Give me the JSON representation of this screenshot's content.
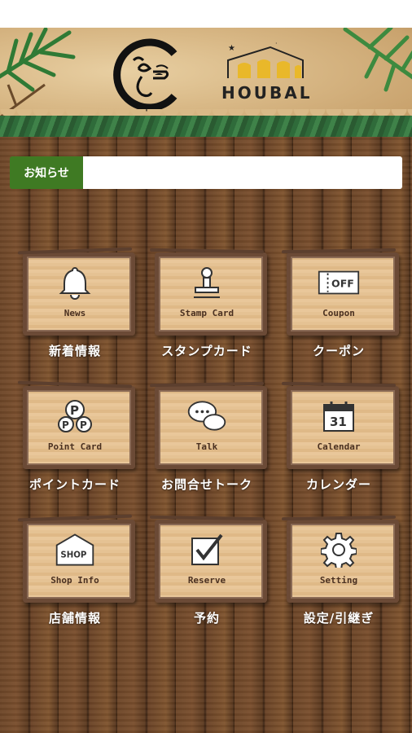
{
  "header": {
    "brand": "HOUBAL"
  },
  "notice": {
    "label": "お知らせ",
    "text": ""
  },
  "menu": [
    {
      "en": "News",
      "jp": "新着情報",
      "icon": "bell-icon"
    },
    {
      "en": "Stamp Card",
      "jp": "スタンプカード",
      "icon": "stamp-icon"
    },
    {
      "en": "Coupon",
      "jp": "クーポン",
      "icon": "coupon-icon",
      "badge": "OFF"
    },
    {
      "en": "Point Card",
      "jp": "ポイントカード",
      "icon": "points-icon"
    },
    {
      "en": "Talk",
      "jp": "お問合せトーク",
      "icon": "chat-icon"
    },
    {
      "en": "Calendar",
      "jp": "カレンダー",
      "icon": "calendar-icon",
      "badge": "31"
    },
    {
      "en": "Shop Info",
      "jp": "店舗情報",
      "icon": "shop-icon",
      "badge": "SHOP"
    },
    {
      "en": "Reserve",
      "jp": "予約",
      "icon": "reserve-icon"
    },
    {
      "en": "Setting",
      "jp": "設定/引継ぎ",
      "icon": "gear-icon"
    }
  ]
}
